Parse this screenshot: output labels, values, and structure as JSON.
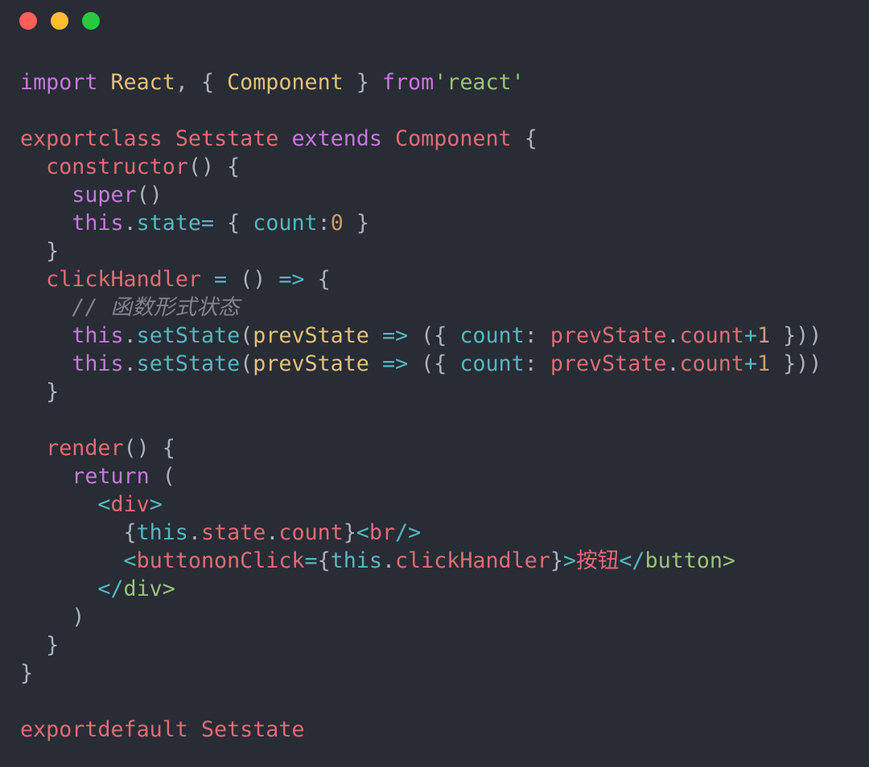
{
  "window": {
    "controls": [
      {
        "name": "close-button",
        "color": "#ff5f56"
      },
      {
        "name": "minimize-button",
        "color": "#ffbd2e"
      },
      {
        "name": "maximize-button",
        "color": "#27c93f"
      }
    ]
  },
  "colors": {
    "p": "#c678dd",
    "y": "#e5c07b",
    "r": "#e06c75",
    "c": "#56b6c2",
    "w": "#abb2bf",
    "g": "#98c379",
    "o": "#d19a66",
    "m": "#7f848e",
    "background": "#282c34"
  },
  "code_lines": [
    [
      [
        "import",
        "p"
      ],
      [
        " ",
        "w"
      ],
      [
        "React",
        "y"
      ],
      [
        ", { ",
        "w"
      ],
      [
        "Component",
        "y"
      ],
      [
        " } ",
        "w"
      ],
      [
        "from",
        "p"
      ],
      [
        "'react'",
        "g"
      ]
    ],
    [],
    [
      [
        "exportclass",
        "r"
      ],
      [
        " ",
        "w"
      ],
      [
        "Setstate",
        "r"
      ],
      [
        " ",
        "w"
      ],
      [
        "extends",
        "p"
      ],
      [
        " ",
        "w"
      ],
      [
        "Component",
        "r"
      ],
      [
        " {",
        "w"
      ]
    ],
    [
      [
        "  ",
        "w"
      ],
      [
        "constructor",
        "r"
      ],
      [
        "() {",
        "w"
      ]
    ],
    [
      [
        "    ",
        "w"
      ],
      [
        "super",
        "p"
      ],
      [
        "()",
        "w"
      ]
    ],
    [
      [
        "    ",
        "w"
      ],
      [
        "this",
        "p"
      ],
      [
        ".",
        "w"
      ],
      [
        "state",
        "c"
      ],
      [
        "=",
        "c"
      ],
      [
        " { ",
        "w"
      ],
      [
        "count",
        "c"
      ],
      [
        ":",
        "w"
      ],
      [
        "0",
        "o"
      ],
      [
        " }",
        "w"
      ]
    ],
    [
      [
        "  }",
        "w"
      ]
    ],
    [
      [
        "  ",
        "w"
      ],
      [
        "clickHandler",
        "r"
      ],
      [
        " = ",
        "c"
      ],
      [
        "() ",
        "w"
      ],
      [
        "=>",
        "c"
      ],
      [
        " {",
        "w"
      ]
    ],
    [
      [
        "    ",
        "w"
      ],
      [
        "// 函数形式状态",
        "m"
      ]
    ],
    [
      [
        "    ",
        "w"
      ],
      [
        "this",
        "p"
      ],
      [
        ".",
        "w"
      ],
      [
        "setState",
        "c"
      ],
      [
        "(",
        "w"
      ],
      [
        "prevState",
        "y"
      ],
      [
        " => ",
        "c"
      ],
      [
        "({ ",
        "w"
      ],
      [
        "count",
        "c"
      ],
      [
        ": ",
        "w"
      ],
      [
        "prevState",
        "r"
      ],
      [
        ".",
        "w"
      ],
      [
        "count",
        "r"
      ],
      [
        "+",
        "c"
      ],
      [
        "1",
        "o"
      ],
      [
        " }))",
        "w"
      ]
    ],
    [
      [
        "    ",
        "w"
      ],
      [
        "this",
        "p"
      ],
      [
        ".",
        "w"
      ],
      [
        "setState",
        "c"
      ],
      [
        "(",
        "w"
      ],
      [
        "prevState",
        "y"
      ],
      [
        " => ",
        "c"
      ],
      [
        "({ ",
        "w"
      ],
      [
        "count",
        "c"
      ],
      [
        ": ",
        "w"
      ],
      [
        "prevState",
        "r"
      ],
      [
        ".",
        "w"
      ],
      [
        "count",
        "r"
      ],
      [
        "+",
        "c"
      ],
      [
        "1",
        "o"
      ],
      [
        " }))",
        "w"
      ]
    ],
    [
      [
        "  }",
        "w"
      ]
    ],
    [],
    [
      [
        "  ",
        "w"
      ],
      [
        "render",
        "r"
      ],
      [
        "() {",
        "w"
      ]
    ],
    [
      [
        "    ",
        "w"
      ],
      [
        "return",
        "p"
      ],
      [
        " (",
        "w"
      ]
    ],
    [
      [
        "      ",
        "w"
      ],
      [
        "<",
        "c"
      ],
      [
        "div",
        "r"
      ],
      [
        ">",
        "c"
      ]
    ],
    [
      [
        "        {",
        "w"
      ],
      [
        "this",
        "c"
      ],
      [
        ".",
        "w"
      ],
      [
        "state",
        "r"
      ],
      [
        ".",
        "w"
      ],
      [
        "count",
        "r"
      ],
      [
        "}",
        "w"
      ],
      [
        "<",
        "c"
      ],
      [
        "br",
        "r"
      ],
      [
        "/>",
        "c"
      ]
    ],
    [
      [
        "        ",
        "w"
      ],
      [
        "<",
        "c"
      ],
      [
        "buttononClick",
        "r"
      ],
      [
        "=",
        "c"
      ],
      [
        "{",
        "w"
      ],
      [
        "this",
        "c"
      ],
      [
        ".",
        "w"
      ],
      [
        "clickHandler",
        "r"
      ],
      [
        "}",
        "w"
      ],
      [
        ">",
        "c"
      ],
      [
        "按钮",
        "r"
      ],
      [
        "</",
        "c"
      ],
      [
        "button>",
        "g"
      ]
    ],
    [
      [
        "      ",
        "w"
      ],
      [
        "</",
        "c"
      ],
      [
        "div>",
        "g"
      ]
    ],
    [
      [
        "    )",
        "w"
      ]
    ],
    [
      [
        "  }",
        "w"
      ]
    ],
    [
      [
        "}",
        "w"
      ]
    ],
    [],
    [
      [
        "exportdefault",
        "r"
      ],
      [
        " Setstate",
        "r"
      ]
    ]
  ]
}
